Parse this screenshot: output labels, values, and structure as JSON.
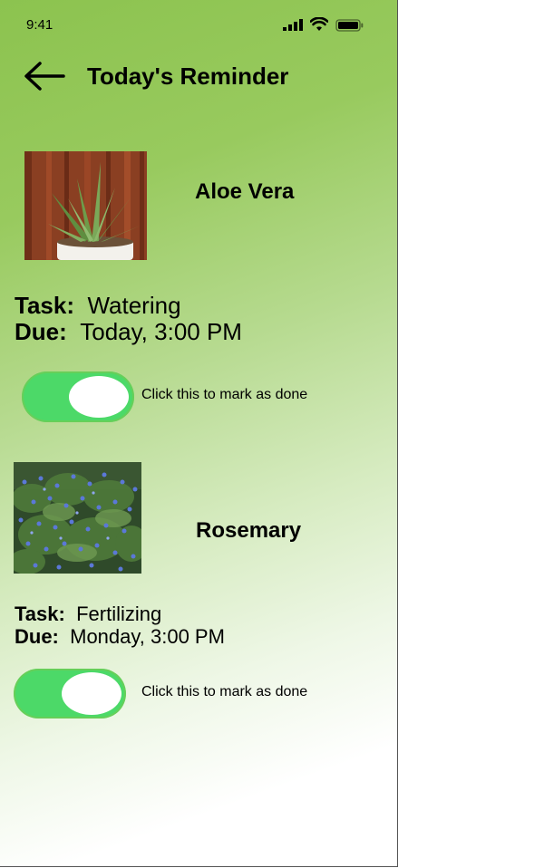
{
  "status_bar": {
    "time": "9:41"
  },
  "header": {
    "title": "Today's Reminder",
    "back_icon": "arrow-left-icon"
  },
  "reminders": [
    {
      "plant": "Aloe Vera",
      "task_label": "Task:",
      "task": "Watering",
      "due_label": "Due:",
      "due": "Today, 3:00 PM",
      "toggle_hint": "Click this to mark as done"
    },
    {
      "plant": "Rosemary",
      "task_label": "Task:",
      "task": "Fertilizing",
      "due_label": "Due:",
      "due": "Monday, 3:00 PM",
      "toggle_hint": "Click this to mark as done"
    }
  ],
  "colors": {
    "accent_green": "#8cc34f",
    "toggle_green": "#4cd968"
  }
}
